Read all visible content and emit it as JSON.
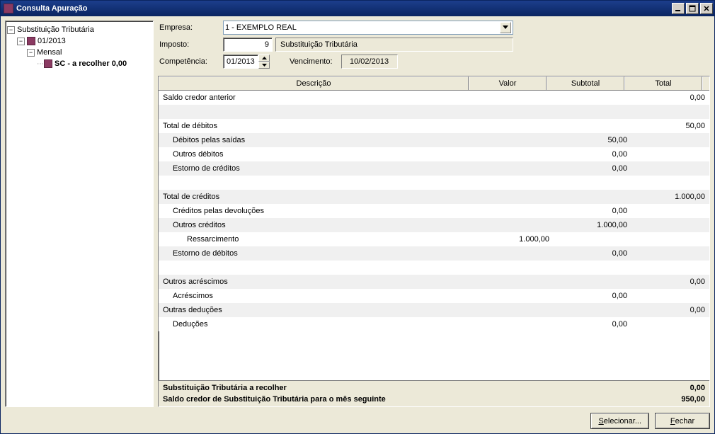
{
  "window": {
    "title": "Consulta Apuração"
  },
  "tree": {
    "root": {
      "label": "Substituição Tributária"
    },
    "period": {
      "label": "01/2013"
    },
    "freq": {
      "label": "Mensal"
    },
    "leaf": {
      "label": "SC - a recolher 0,00"
    }
  },
  "form": {
    "labels": {
      "empresa": "Empresa:",
      "imposto": "Imposto:",
      "competencia": "Competência:",
      "vencimento": "Vencimento:"
    },
    "empresa": {
      "value": "1 - EXEMPLO REAL"
    },
    "imposto": {
      "code": "9",
      "desc": "Substituição Tributária"
    },
    "competencia": {
      "value": "01/2013"
    },
    "vencimento": {
      "value": "10/02/2013"
    }
  },
  "grid": {
    "headers": {
      "descricao": "Descrição",
      "valor": "Valor",
      "subtotal": "Subtotal",
      "total": "Total"
    },
    "rows": [
      {
        "desc": "Saldo credor anterior",
        "valor": "",
        "subtotal": "",
        "total": "0,00",
        "indent": 0,
        "stripe": "white"
      },
      {
        "desc": "",
        "indent": 0,
        "stripe": "gray",
        "blank": true
      },
      {
        "desc": "Total de débitos",
        "valor": "",
        "subtotal": "",
        "total": "50,00",
        "indent": 0,
        "stripe": "white"
      },
      {
        "desc": "Débitos pelas saídas",
        "valor": "",
        "subtotal": "50,00",
        "total": "",
        "indent": 1,
        "stripe": "gray"
      },
      {
        "desc": "Outros débitos",
        "valor": "",
        "subtotal": "0,00",
        "total": "",
        "indent": 1,
        "stripe": "white"
      },
      {
        "desc": "Estorno de créditos",
        "valor": "",
        "subtotal": "0,00",
        "total": "",
        "indent": 1,
        "stripe": "gray"
      },
      {
        "desc": "",
        "indent": 0,
        "stripe": "white",
        "blank": true
      },
      {
        "desc": "Total de créditos",
        "valor": "",
        "subtotal": "",
        "total": "1.000,00",
        "indent": 0,
        "stripe": "gray"
      },
      {
        "desc": "Créditos pelas devoluções",
        "valor": "",
        "subtotal": "0,00",
        "total": "",
        "indent": 1,
        "stripe": "white"
      },
      {
        "desc": "Outros créditos",
        "valor": "",
        "subtotal": "1.000,00",
        "total": "",
        "indent": 1,
        "stripe": "gray"
      },
      {
        "desc": "Ressarcimento",
        "valor": "1.000,00",
        "subtotal": "",
        "total": "",
        "indent": 2,
        "stripe": "white"
      },
      {
        "desc": "Estorno de débitos",
        "valor": "",
        "subtotal": "0,00",
        "total": "",
        "indent": 1,
        "stripe": "gray"
      },
      {
        "desc": "",
        "indent": 0,
        "stripe": "white",
        "blank": true
      },
      {
        "desc": "Outros acréscimos",
        "valor": "",
        "subtotal": "",
        "total": "0,00",
        "indent": 0,
        "stripe": "gray"
      },
      {
        "desc": "Acréscimos",
        "valor": "",
        "subtotal": "0,00",
        "total": "",
        "indent": 1,
        "stripe": "white"
      },
      {
        "desc": "Outras deduções",
        "valor": "",
        "subtotal": "",
        "total": "0,00",
        "indent": 0,
        "stripe": "gray"
      },
      {
        "desc": "Deduções",
        "valor": "",
        "subtotal": "0,00",
        "total": "",
        "indent": 1,
        "stripe": "white"
      }
    ],
    "summary": [
      {
        "label": "Substituição Tributária a recolher",
        "value": "0,00"
      },
      {
        "label": "Saldo credor de Substituição Tributária para o mês seguinte",
        "value": "950,00"
      }
    ]
  },
  "buttons": {
    "selecionar": "Selecionar...",
    "fechar": "Fechar",
    "selecionar_u": "S",
    "fechar_u": "F"
  }
}
